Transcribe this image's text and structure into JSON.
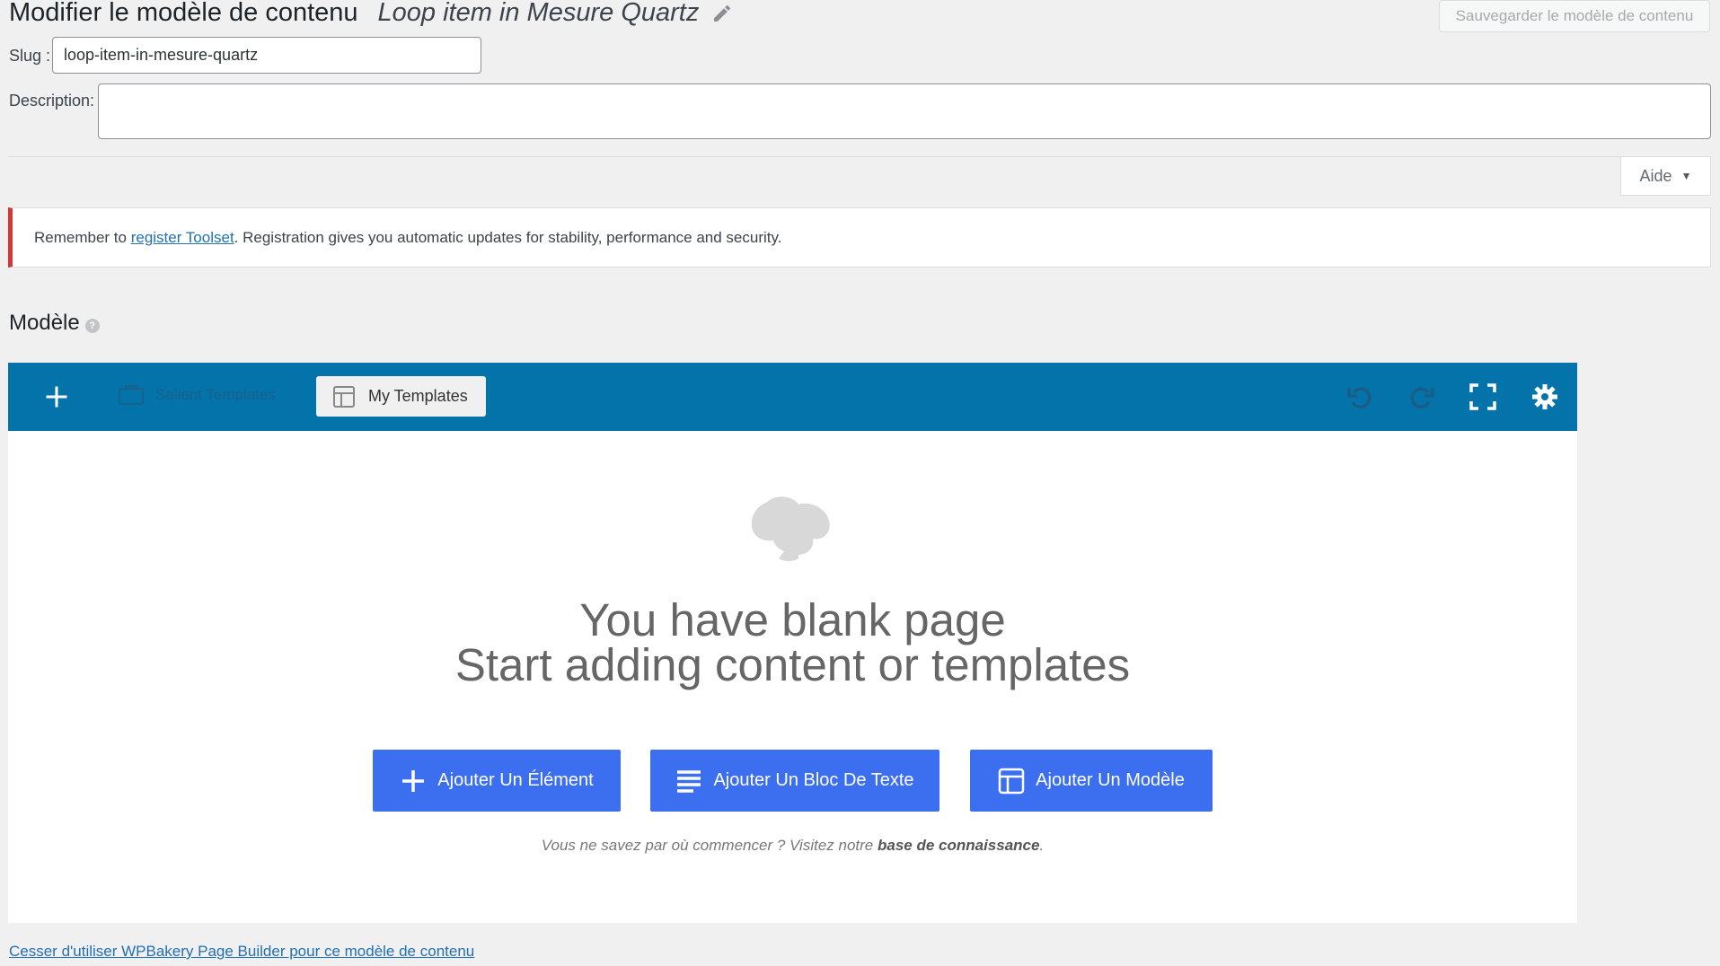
{
  "header": {
    "title": "Modifier le modèle de contenu",
    "item_name": "Loop item in Mesure Quartz",
    "save_label": "Sauvegarder le modèle de contenu"
  },
  "slug": {
    "label": "Slug :",
    "value": "loop-item-in-mesure-quartz"
  },
  "description": {
    "label": "Description:",
    "value": ""
  },
  "help": {
    "label": "Aide"
  },
  "notice": {
    "prefix": "Remember to ",
    "link_text": "register Toolset",
    "suffix": ". Registration gives you automatic updates for stability, performance and security."
  },
  "section": {
    "title": "Modèle",
    "help_glyph": "?"
  },
  "toolbar": {
    "salient_label": "Salient Templates",
    "my_templates_label": "My Templates",
    "icons": [
      "plus-icon",
      "undo-icon",
      "redo-icon",
      "fullscreen-icon",
      "gear-icon"
    ]
  },
  "builder": {
    "empty_line1": "You have blank page",
    "empty_line2": "Start adding content or templates",
    "add_element_label": "Ajouter Un Élément",
    "add_text_block_label": "Ajouter Un Bloc De Texte",
    "add_template_label": "Ajouter Un Modèle",
    "hint_prefix": "Vous ne savez par où commencer ? Visitez notre ",
    "hint_link": "base de connaissance",
    "hint_suffix": "."
  },
  "footer": {
    "link_text": "Cesser d'utiliser WPBakery Page Builder pour ce modèle de contenu"
  },
  "colors": {
    "toolbar": "#0473aa",
    "button": "#3c6ff0",
    "notice_border": "#d63638",
    "link": "#2271b1"
  }
}
